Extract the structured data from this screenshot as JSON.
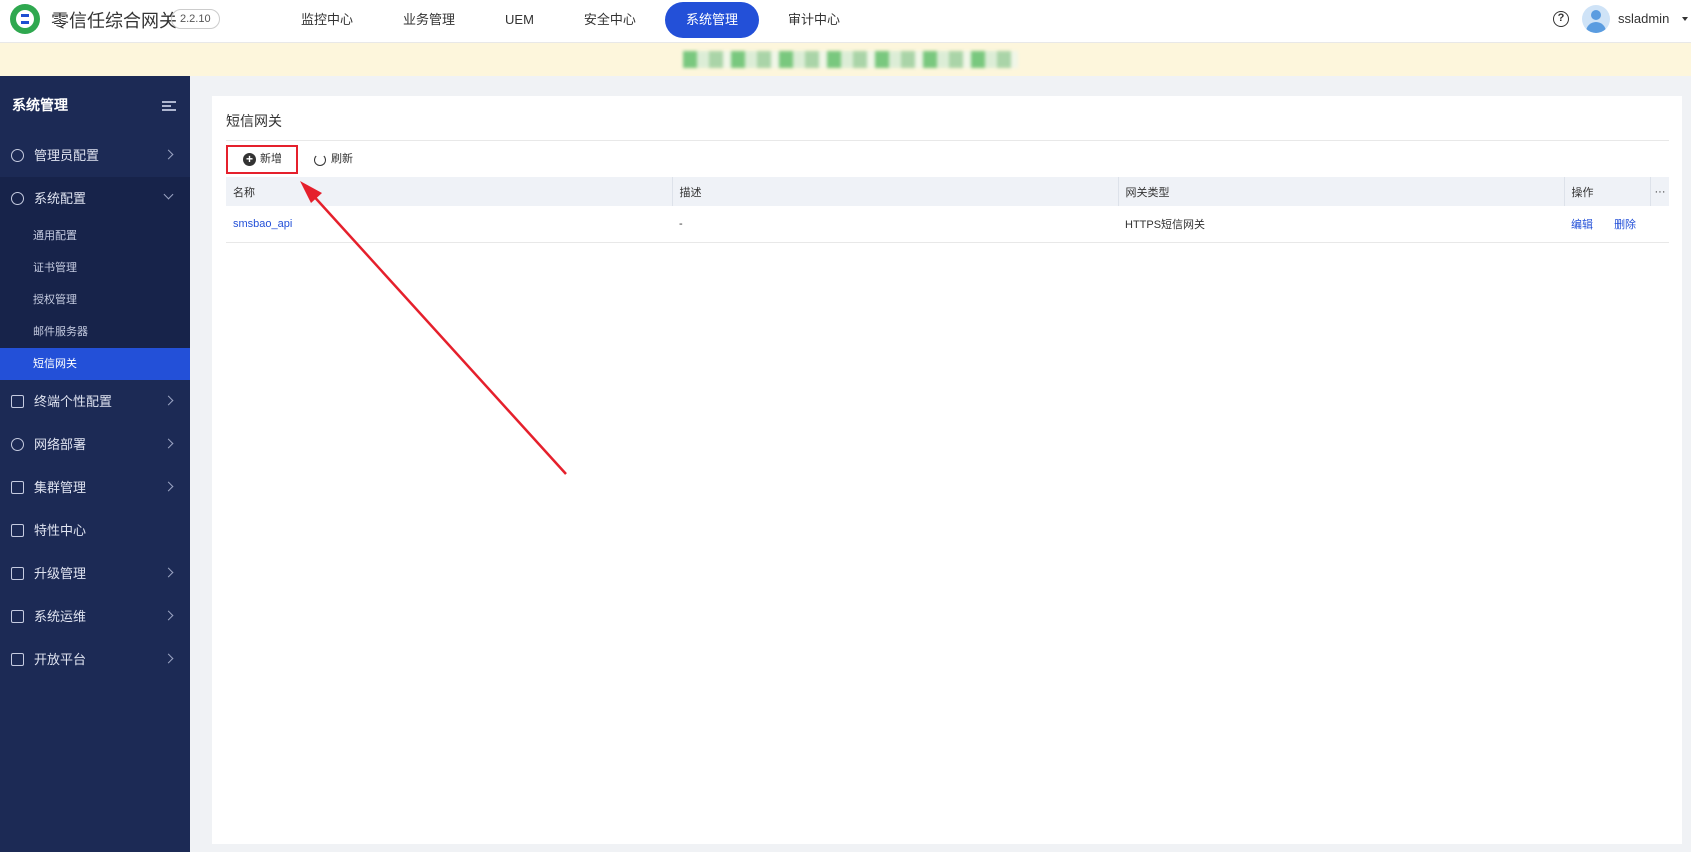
{
  "app": {
    "title": "零信任综合网关",
    "version": "2.2.10"
  },
  "nav": {
    "items": [
      "监控中心",
      "业务管理",
      "UEM",
      "安全中心",
      "系统管理",
      "审计中心"
    ],
    "active": "系统管理"
  },
  "user": {
    "name": "ssladmin",
    "help_icon": "question-circle-icon"
  },
  "sidebar": {
    "title": "系统管理",
    "items": [
      {
        "label": "管理员配置",
        "icon": "admin-icon"
      },
      {
        "label": "系统配置",
        "icon": "gear-icon"
      },
      {
        "label": "终端个性配置",
        "icon": "monitor-icon"
      },
      {
        "label": "网络部署",
        "icon": "globe-icon"
      },
      {
        "label": "集群管理",
        "icon": "cluster-icon"
      },
      {
        "label": "特性中心",
        "icon": "grid-icon"
      },
      {
        "label": "升级管理",
        "icon": "upload-icon"
      },
      {
        "label": "系统运维",
        "icon": "pulse-icon"
      },
      {
        "label": "开放平台",
        "icon": "platform-icon"
      }
    ],
    "sub_items": [
      "通用配置",
      "证书管理",
      "授权管理",
      "邮件服务器",
      "短信网关"
    ],
    "active_sub": "短信网关"
  },
  "main": {
    "title": "短信网关",
    "add_label": "新增",
    "refresh_label": "刷新",
    "table": {
      "columns": [
        "名称",
        "描述",
        "网关类型",
        "操作",
        "···"
      ],
      "rows": [
        {
          "name": "smsbao_api",
          "desc": "-",
          "type": "HTTPS短信网关",
          "edit": "编辑",
          "delete": "删除"
        }
      ]
    }
  },
  "colors": {
    "accent": "#2350d8",
    "sidebar_bg": "#1c2a55",
    "annotation": "#e5202c"
  }
}
